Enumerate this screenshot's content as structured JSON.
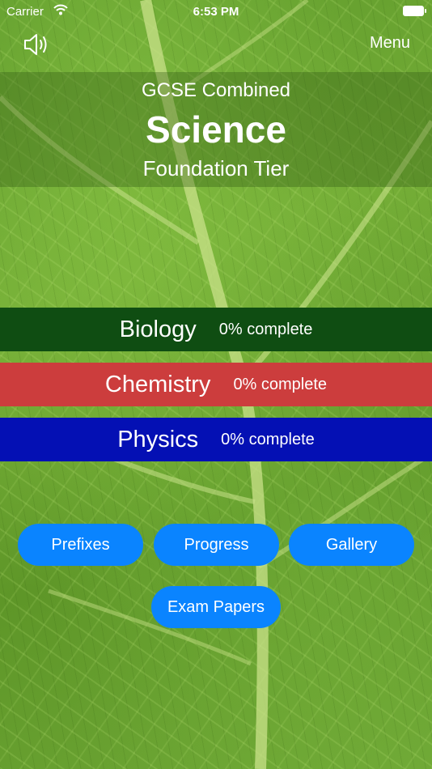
{
  "status_bar": {
    "carrier": "Carrier",
    "time": "6:53 PM"
  },
  "header": {
    "menu_label": "Menu",
    "sound_icon": "speaker-icon"
  },
  "title": {
    "subtitle": "GCSE Combined",
    "main": "Science",
    "tier": "Foundation Tier"
  },
  "subjects": [
    {
      "name": "Biology",
      "progress": "0% complete",
      "color": "#0f4d12"
    },
    {
      "name": "Chemistry",
      "progress": "0% complete",
      "color": "#cc3d3d"
    },
    {
      "name": "Physics",
      "progress": "0% complete",
      "color": "#0410b4"
    }
  ],
  "buttons": {
    "prefixes": "Prefixes",
    "progress": "Progress",
    "gallery": "Gallery",
    "exam_papers": "Exam Papers"
  },
  "colors": {
    "button_blue": "#0a84ff"
  }
}
